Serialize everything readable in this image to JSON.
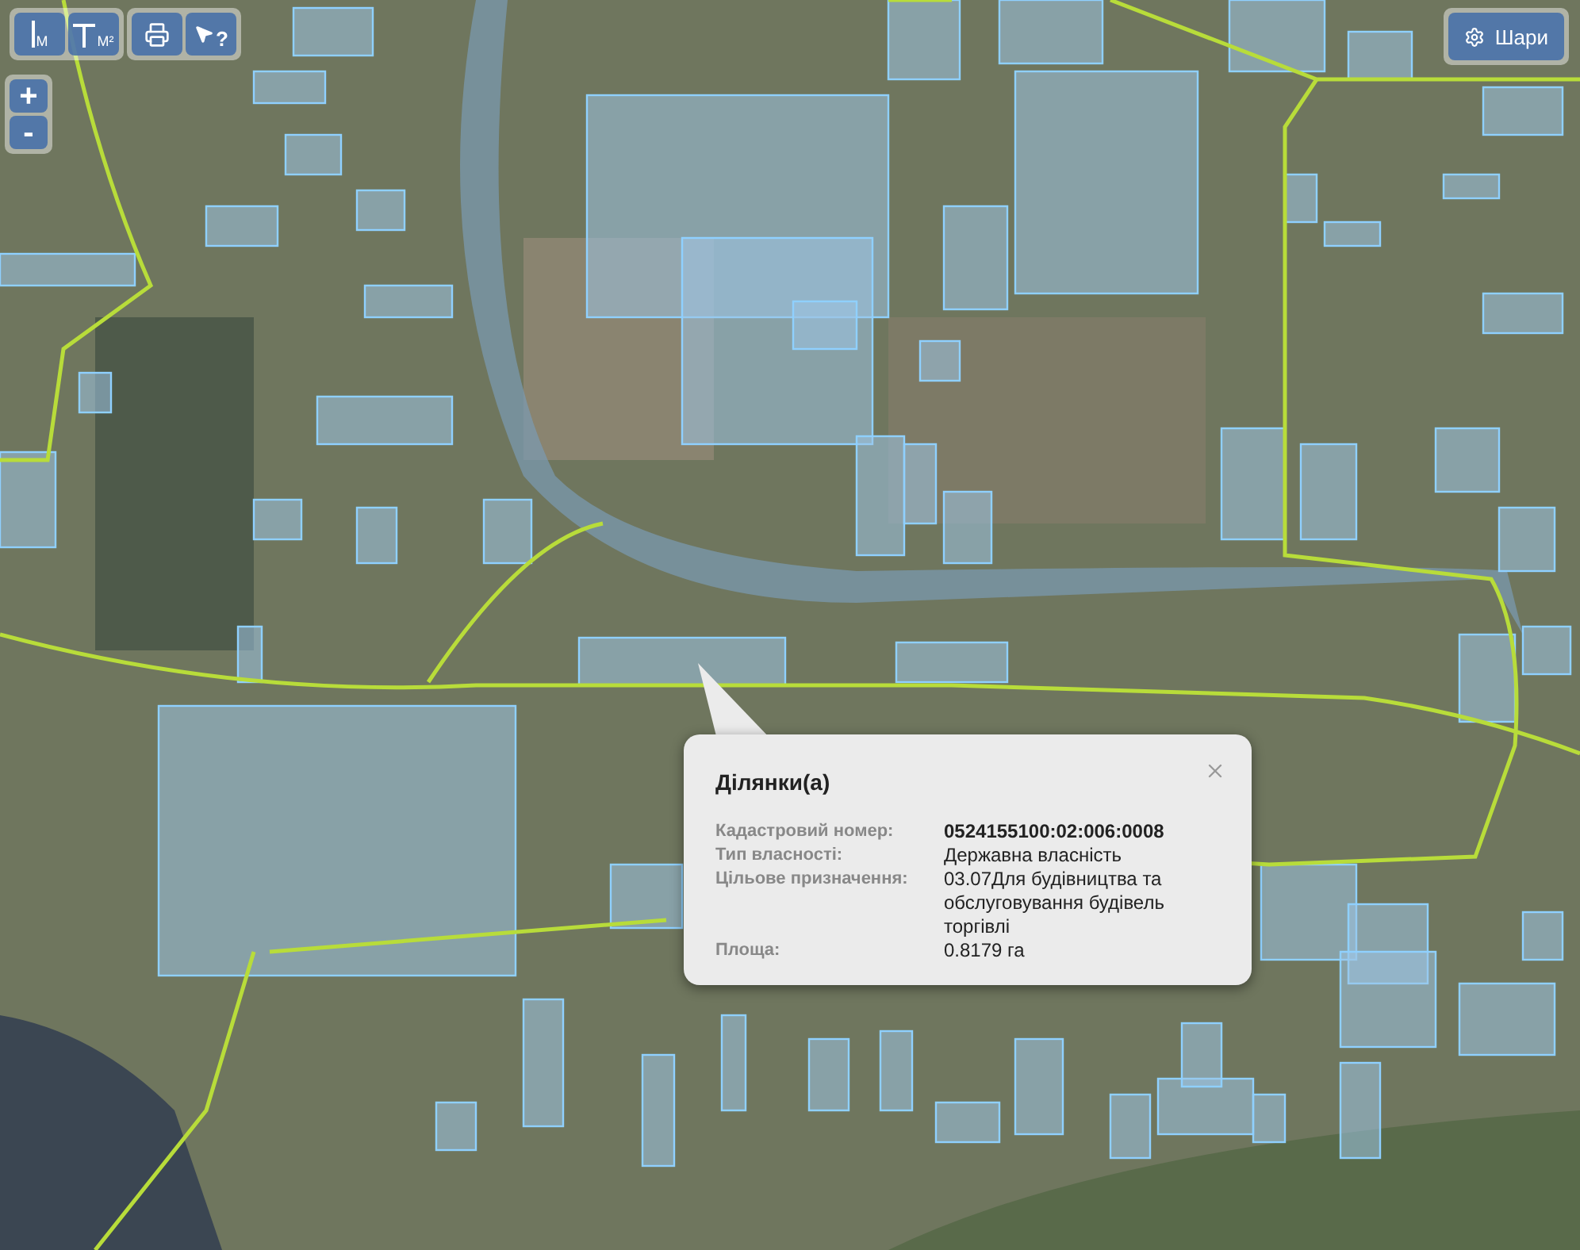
{
  "toolbar": {
    "measure_buttons": [
      {
        "kind": "length",
        "unit": "M"
      },
      {
        "kind": "area",
        "unit": "M²"
      }
    ],
    "identify_label": "?"
  },
  "zoom": {
    "in": "+",
    "out": "-"
  },
  "layers_button": {
    "label": "Шари"
  },
  "popup": {
    "title": "Ділянки(а)",
    "fields": [
      {
        "label": "Кадастровий номер:",
        "value": "0524155100:02:006:0008",
        "bold": true
      },
      {
        "label": "Тип власності:",
        "value": "Державна власність",
        "bold": false
      },
      {
        "label": "Цільове призначення:",
        "value": "03.07Для будівництва та обслуговування будівель торгівлі",
        "bold": false
      },
      {
        "label": "Площа:",
        "value": "0.8179 га",
        "bold": false
      }
    ]
  }
}
